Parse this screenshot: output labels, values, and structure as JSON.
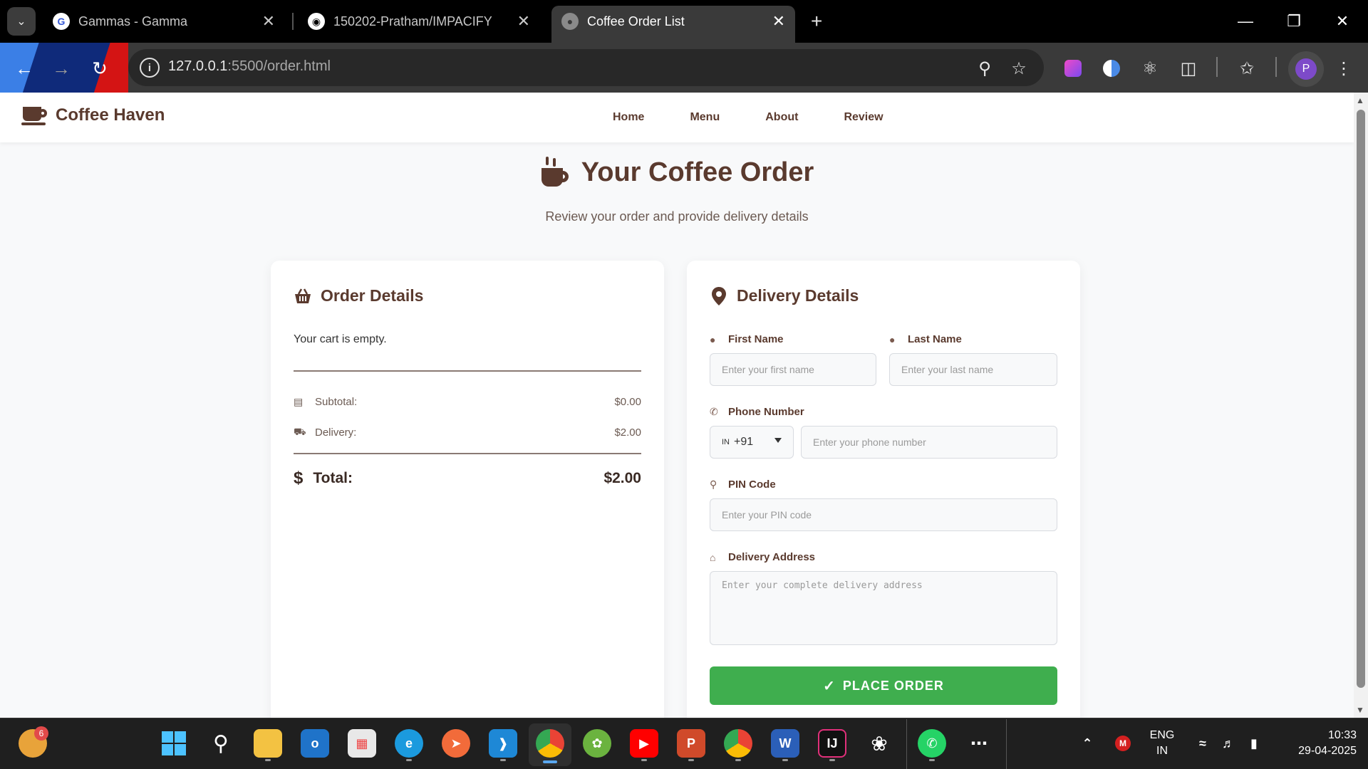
{
  "browser": {
    "tabs": [
      {
        "title": "Gammas - Gamma",
        "icon": "gamma-icon"
      },
      {
        "title": "150202-Pratham/IMPACIFY",
        "icon": "github-icon"
      },
      {
        "title": "Coffee Order List",
        "icon": "globe-icon"
      }
    ],
    "active_tab": 2,
    "url_host": "127.0.0.1",
    "url_rest": ":5500/order.html",
    "profile_initial": "P"
  },
  "site": {
    "brand": "Coffee Haven",
    "nav": [
      "Home",
      "Menu",
      "About",
      "Review"
    ]
  },
  "hero": {
    "title": "Your Coffee Order",
    "subtitle": "Review your order and provide delivery details"
  },
  "order": {
    "title": "Order Details",
    "empty_message": "Your cart is empty.",
    "subtotal_label": "Subtotal:",
    "subtotal_value": "$0.00",
    "delivery_label": "Delivery:",
    "delivery_value": "$2.00",
    "total_label": "Total:",
    "total_value": "$2.00"
  },
  "delivery": {
    "title": "Delivery Details",
    "first_name_label": "First Name",
    "first_name_placeholder": "Enter your first name",
    "last_name_label": "Last Name",
    "last_name_placeholder": "Enter your last name",
    "phone_label": "Phone Number",
    "country_flag": "IN",
    "country_code": "+91",
    "phone_placeholder": "Enter your phone number",
    "pin_label": "PIN Code",
    "pin_placeholder": "Enter your PIN code",
    "address_label": "Delivery Address",
    "address_placeholder": "Enter your complete delivery address",
    "submit_label": "PLACE ORDER"
  },
  "taskbar": {
    "notification_count": "6",
    "language": "ENG",
    "region": "IN",
    "time": "10:33",
    "date": "29-04-2025"
  },
  "colors": {
    "brand": "#5a3a2e",
    "button": "#3fae4e",
    "page_bg": "#f8f9fa"
  }
}
